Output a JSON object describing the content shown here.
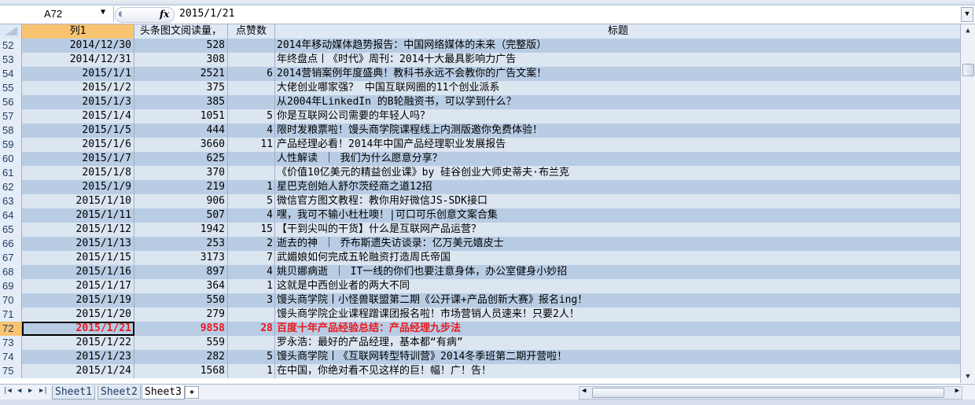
{
  "name_box": "A72",
  "formula_value": "2015/1/21",
  "columns": {
    "A": "列1",
    "B": "头条图文阅读量，",
    "C": "点赞数",
    "D": "标题"
  },
  "rows": [
    {
      "n": "52",
      "date": "2014/12/30",
      "reads": "528",
      "likes": "",
      "title": "2014年移动媒体趋势报告：中国网络媒体的未来（完整版）"
    },
    {
      "n": "53",
      "date": "2014/12/31",
      "reads": "308",
      "likes": "",
      "title": "年终盘点丨《时代》周刊：2014十大最具影响力广告"
    },
    {
      "n": "54",
      "date": "2015/1/1",
      "reads": "2521",
      "likes": "6",
      "title": "2014营销案例年度盛典！教科书永远不会教你的广告文案！"
    },
    {
      "n": "55",
      "date": "2015/1/2",
      "reads": "375",
      "likes": "",
      "title": "大佬创业哪家强？ 中国互联网圈的11个创业派系"
    },
    {
      "n": "56",
      "date": "2015/1/3",
      "reads": "385",
      "likes": "",
      "title": "从2004年LinkedIn 的B轮融资书，可以学到什么？"
    },
    {
      "n": "57",
      "date": "2015/1/4",
      "reads": "1051",
      "likes": "5",
      "title": "你是互联网公司需要的年轻人吗？"
    },
    {
      "n": "58",
      "date": "2015/1/5",
      "reads": "444",
      "likes": "4",
      "title": "限时发粮票啦！馒头商学院课程线上内测版邀你免费体验！"
    },
    {
      "n": "59",
      "date": "2015/1/6",
      "reads": "3660",
      "likes": "11",
      "title": "产品经理必看！2014年中国产品经理职业发展报告"
    },
    {
      "n": "60",
      "date": "2015/1/7",
      "reads": "625",
      "likes": "",
      "title": "人性解读 ｜ 我们为什么愿意分享？"
    },
    {
      "n": "61",
      "date": "2015/1/8",
      "reads": "370",
      "likes": "",
      "title": "《价值10亿美元的精益创业课》by 硅谷创业大师史蒂夫·布兰克"
    },
    {
      "n": "62",
      "date": "2015/1/9",
      "reads": "219",
      "likes": "1",
      "title": "星巴克创始人舒尔茨经商之道12招"
    },
    {
      "n": "63",
      "date": "2015/1/10",
      "reads": "906",
      "likes": "5",
      "title": "微信官方图文教程：教你用好微信JS-SDK接口"
    },
    {
      "n": "64",
      "date": "2015/1/11",
      "reads": "507",
      "likes": "4",
      "title": "嘿，我可不输小杜杜噢！|可口可乐创意文案合集"
    },
    {
      "n": "65",
      "date": "2015/1/12",
      "reads": "1942",
      "likes": "15",
      "title": "【干到尖叫的干货】什么是互联网产品运营？"
    },
    {
      "n": "66",
      "date": "2015/1/13",
      "reads": "253",
      "likes": "2",
      "title": "逝去的神 ｜ 乔布斯遗失访谈录：亿万美元嬉皮士"
    },
    {
      "n": "67",
      "date": "2015/1/15",
      "reads": "3173",
      "likes": "7",
      "title": "武媚娘如何完成五轮融资打造周氏帝国"
    },
    {
      "n": "68",
      "date": "2015/1/16",
      "reads": "897",
      "likes": "4",
      "title": "姚贝娜病逝 ｜ IT一线的你们也要注意身体，办公室健身小妙招"
    },
    {
      "n": "69",
      "date": "2015/1/17",
      "reads": "364",
      "likes": "1",
      "title": "这就是中西创业者的两大不同"
    },
    {
      "n": "70",
      "date": "2015/1/19",
      "reads": "550",
      "likes": "3",
      "title": "馒头商学院丨小怪兽联盟第二期《公开课+产品创新大赛》报名ing！"
    },
    {
      "n": "71",
      "date": "2015/1/20",
      "reads": "279",
      "likes": "",
      "title": "馒头商学院企业课程蹭课团报名啦！市场营销人员速来！只要2人！"
    },
    {
      "n": "72",
      "date": "2015/1/21",
      "reads": "9858",
      "likes": "28",
      "title": "百度十年产品经验总结：产品经理九步法",
      "highlight": true
    },
    {
      "n": "73",
      "date": "2015/1/22",
      "reads": "559",
      "likes": "",
      "title": "罗永浩：最好的产品经理，基本都“有病”"
    },
    {
      "n": "74",
      "date": "2015/1/23",
      "reads": "282",
      "likes": "5",
      "title": "馒头商学院丨《互联网转型特训营》2014冬季班第二期开营啦！"
    },
    {
      "n": "75",
      "date": "2015/1/24",
      "reads": "1568",
      "likes": "1",
      "title": "在中国，你绝对看不见这样的巨！幅！广！告！"
    }
  ],
  "sheets": [
    "Sheet1",
    "Sheet2",
    "Sheet3"
  ],
  "active_sheet": "Sheet3",
  "colors": {
    "band_dark": "#b8cce4",
    "band_light": "#dce6f1",
    "selected_header": "#f8c472",
    "highlight_text": "#e8191e"
  }
}
